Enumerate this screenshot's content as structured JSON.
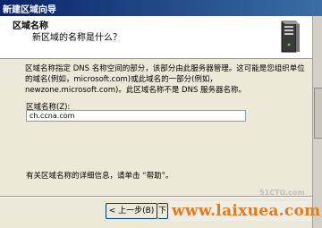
{
  "window": {
    "title": "新建区域向导"
  },
  "header": {
    "title": "区域名称",
    "subtitle": "新区域的名称是什么？"
  },
  "body": {
    "description": "区域名称指定 DNS 名称空间的部分，该部分由此服务器管理。这可能是您组织单位的域名(例如，microsoft.com)或此域名的一部分(例如，newzone.microsoft.com)。此区域名称不是 DNS 服务器名称。",
    "field_label": "区域名称(Z):",
    "field_value": "ch.ccna.com",
    "help_text": "有关区域名称的详细信息，请单击 “帮助”。"
  },
  "footer": {
    "back_label": "< 上一步(B)",
    "next_label": "下"
  },
  "watermark": {
    "site": "www.laixuea.com",
    "logo": "51CTO.com"
  },
  "colors": {
    "titlebar": "#0a246a",
    "background": "#ece9d8",
    "watermark": "#e07b1f"
  }
}
